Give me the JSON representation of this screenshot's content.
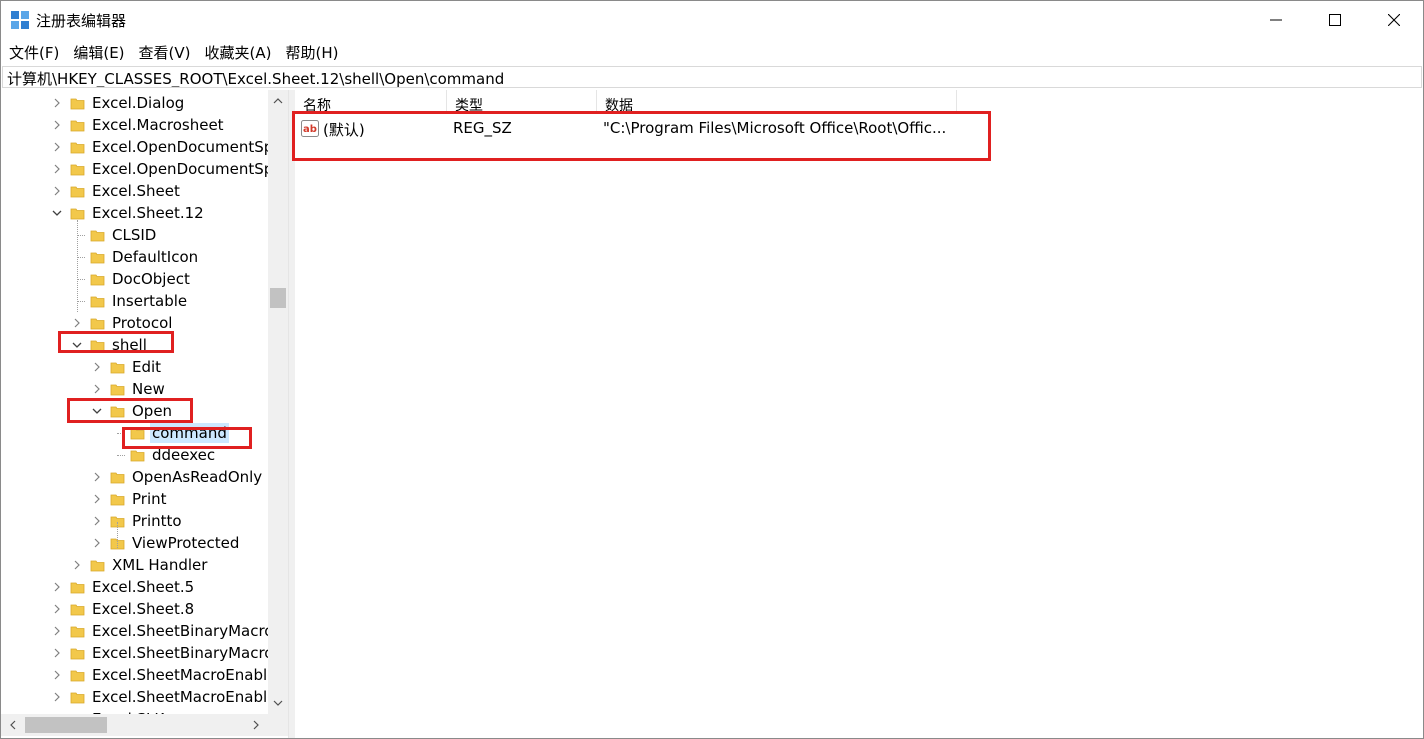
{
  "window": {
    "title": "注册表编辑器"
  },
  "menu": [
    "文件(F)",
    "编辑(E)",
    "查看(V)",
    "收藏夹(A)",
    "帮助(H)"
  ],
  "address": "计算机\\HKEY_CLASSES_ROOT\\Excel.Sheet.12\\shell\\Open\\command",
  "tree": [
    {
      "label": "Excel.Dialog",
      "expander": "collapsed"
    },
    {
      "label": "Excel.Macrosheet",
      "expander": "collapsed"
    },
    {
      "label": "Excel.OpenDocumentSp",
      "expander": "collapsed"
    },
    {
      "label": "Excel.OpenDocumentSp",
      "expander": "collapsed"
    },
    {
      "label": "Excel.Sheet",
      "expander": "collapsed"
    },
    {
      "label": "Excel.Sheet.12",
      "expander": "expanded"
    },
    {
      "label": "CLSID",
      "expander": "none"
    },
    {
      "label": "DefaultIcon",
      "expander": "none"
    },
    {
      "label": "DocObject",
      "expander": "none"
    },
    {
      "label": "Insertable",
      "expander": "none"
    },
    {
      "label": "Protocol",
      "expander": "collapsed"
    },
    {
      "label": "shell",
      "expander": "expanded"
    },
    {
      "label": "Edit",
      "expander": "collapsed"
    },
    {
      "label": "New",
      "expander": "collapsed"
    },
    {
      "label": "Open",
      "expander": "expanded"
    },
    {
      "label": "command",
      "expander": "none",
      "selected": true
    },
    {
      "label": "ddeexec",
      "expander": "none"
    },
    {
      "label": "OpenAsReadOnly",
      "expander": "collapsed"
    },
    {
      "label": "Print",
      "expander": "collapsed"
    },
    {
      "label": "Printto",
      "expander": "collapsed"
    },
    {
      "label": "ViewProtected",
      "expander": "collapsed"
    },
    {
      "label": "XML Handler",
      "expander": "collapsed"
    },
    {
      "label": "Excel.Sheet.5",
      "expander": "collapsed"
    },
    {
      "label": "Excel.Sheet.8",
      "expander": "collapsed"
    },
    {
      "label": "Excel.SheetBinaryMacro",
      "expander": "collapsed"
    },
    {
      "label": "Excel.SheetBinaryMacro",
      "expander": "collapsed"
    },
    {
      "label": "Excel.SheetMacroEnable",
      "expander": "collapsed"
    },
    {
      "label": "Excel.SheetMacroEnable",
      "expander": "collapsed"
    },
    {
      "label": "Excel.SLK",
      "expander": "collapsed"
    }
  ],
  "columns": {
    "name": "名称",
    "type": "类型",
    "data": "数据"
  },
  "values": [
    {
      "name": "(默认)",
      "type": "REG_SZ",
      "data": "\"C:\\Program Files\\Microsoft Office\\Root\\Offic..."
    }
  ],
  "colors": {
    "highlight": "#e02020",
    "selection": "#cce8ff",
    "folder": "#f2c84b"
  }
}
